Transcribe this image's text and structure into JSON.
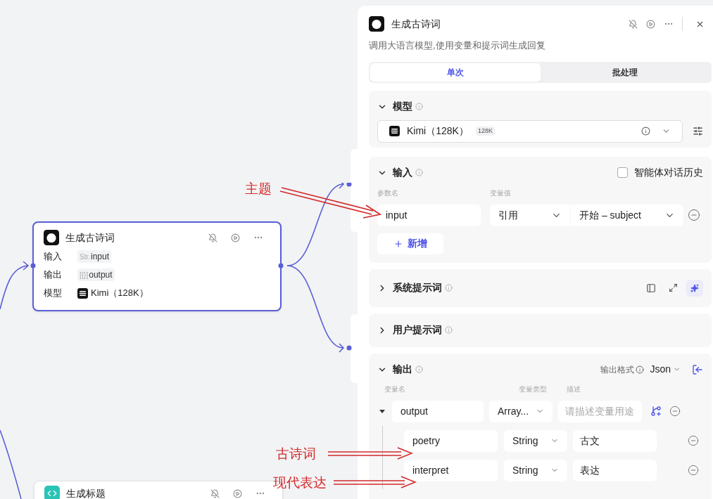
{
  "canvas": {
    "nodes": [
      {
        "kind": "llm",
        "title": "生成古诗词",
        "selected": true,
        "rows": [
          {
            "kind": "tag",
            "label": "输入",
            "tag": "Str.",
            "value": "input"
          },
          {
            "kind": "tag",
            "label": "输出",
            "tag": "[{}]",
            "value": "output"
          },
          {
            "kind": "model",
            "label": "模型",
            "value": "Kimi（128K）"
          }
        ]
      },
      {
        "kind": "code",
        "title": "生成标题",
        "selected": false
      }
    ],
    "annotations": [
      {
        "text": "主题"
      },
      {
        "text": "古诗词"
      },
      {
        "text": "现代表达"
      }
    ]
  },
  "panel": {
    "title": "生成古诗词",
    "description": "调用大语言模型,使用变量和提示词生成回复",
    "tabs": [
      {
        "label": "单次",
        "selected": true
      },
      {
        "label": "批处理",
        "selected": false
      }
    ],
    "model_section": {
      "title": "模型",
      "expanded": true,
      "model": "Kimi（128K）",
      "badge": "128K"
    },
    "input_section": {
      "title": "输入",
      "expanded": true,
      "history": {
        "label": "智能体对话历史",
        "checked": false
      },
      "columns": [
        "参数名",
        "变量值"
      ],
      "params": [
        {
          "name": "input",
          "mode": "引用",
          "value": "开始 – subject"
        }
      ],
      "add_button": "新增"
    },
    "system_prompt": {
      "title": "系统提示词",
      "expanded": false
    },
    "user_prompt": {
      "title": "用户提示词",
      "expanded": false
    },
    "output_section": {
      "title": "输出",
      "expanded": true,
      "format_label": "输出格式",
      "format": "Json",
      "columns": [
        "变量名",
        "变量类型",
        "描述"
      ],
      "variables": [
        {
          "name": "output",
          "type": "Array...",
          "placeholder": "请描述变量用途",
          "expanded": true,
          "children": [
            {
              "name": "poetry",
              "type": "String",
              "description": "古文"
            },
            {
              "name": "interpret",
              "type": "String",
              "description": "表达"
            }
          ]
        }
      ]
    }
  }
}
